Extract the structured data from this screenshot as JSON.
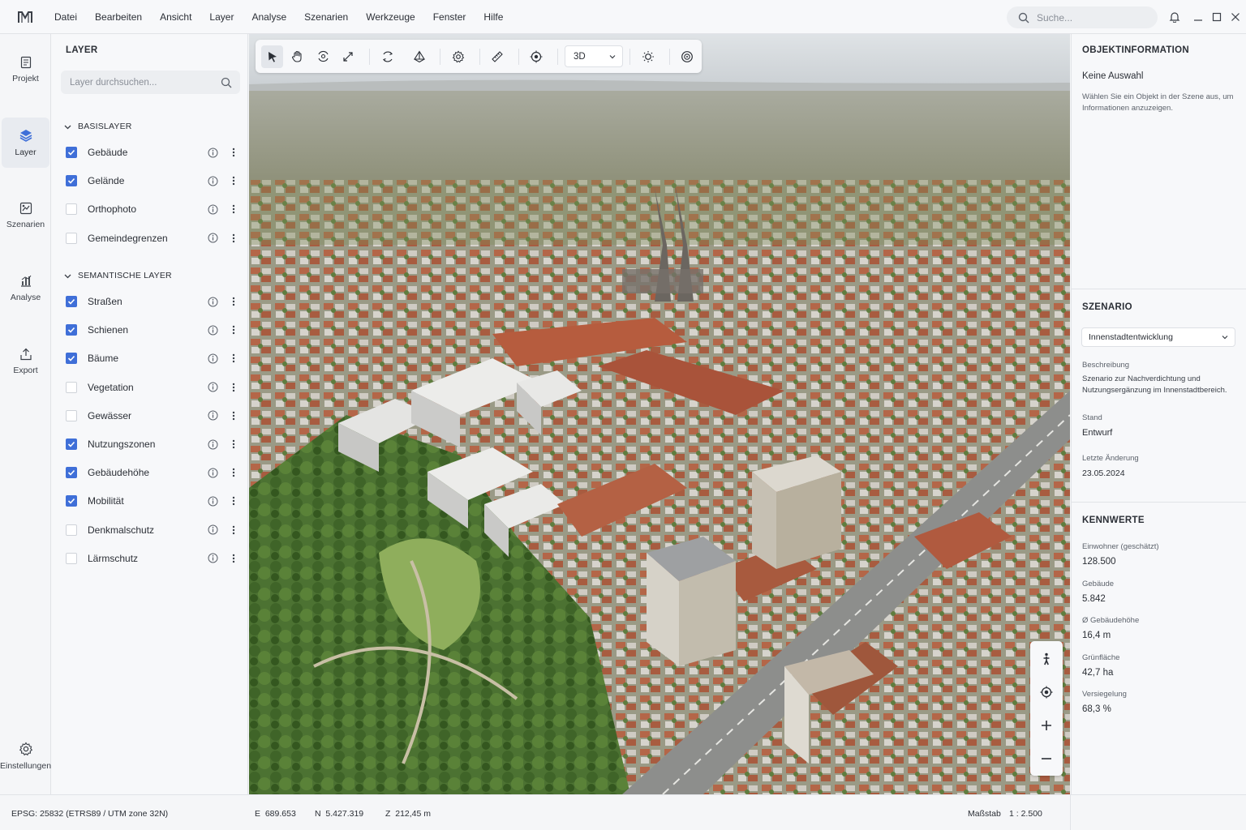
{
  "menu": {
    "logo": "M",
    "items": [
      "Datei",
      "Bearbeiten",
      "Ansicht",
      "Layer",
      "Analyse",
      "Szenarien",
      "Werkzeuge",
      "Fenster",
      "Hilfe"
    ]
  },
  "search": {
    "placeholder": "Suche..."
  },
  "window_controls": [
    "bell-icon",
    "minimize-icon",
    "maximize-icon",
    "close-icon"
  ],
  "rail": {
    "items": [
      {
        "label": "Projekt",
        "icon": "document-icon",
        "active": false
      },
      {
        "label": "Layer",
        "icon": "layers-icon",
        "active": true
      },
      {
        "label": "Szenarien",
        "icon": "scenario-icon",
        "active": false
      },
      {
        "label": "Analyse",
        "icon": "chart-icon",
        "active": false
      },
      {
        "label": "Export",
        "icon": "export-icon",
        "active": false
      }
    ],
    "settings_label": "Einstellungen"
  },
  "layers": {
    "title": "LAYER",
    "search_placeholder": "Layer durchsuchen...",
    "groups": [
      {
        "title": "BASISLAYER",
        "items": [
          {
            "label": "Gebäude",
            "checked": true
          },
          {
            "label": "Gelände",
            "checked": true
          },
          {
            "label": "Orthophoto",
            "checked": false
          },
          {
            "label": "Gemeindegrenzen",
            "checked": false
          }
        ]
      },
      {
        "title": "SEMANTISCHE LAYER",
        "items": [
          {
            "label": "Straßen",
            "checked": true
          },
          {
            "label": "Schienen",
            "checked": true
          },
          {
            "label": "Bäume",
            "checked": true
          },
          {
            "label": "Vegetation",
            "checked": false
          },
          {
            "label": "Gewässer",
            "checked": false
          },
          {
            "label": "Nutzungszonen",
            "checked": true
          },
          {
            "label": "Gebäudehöhe",
            "checked": true
          },
          {
            "label": "Mobilität",
            "checked": true
          },
          {
            "label": "Denkmalschutz",
            "checked": false
          },
          {
            "label": "Lärmschutz",
            "checked": false
          }
        ]
      }
    ]
  },
  "toolbar": {
    "tools": [
      "select-icon",
      "pan-icon",
      "rotate-view-icon",
      "fullscreen-icon",
      "orbit-icon",
      "terrain-icon",
      "settings-icon",
      "measure-icon",
      "target-icon"
    ],
    "view_mode": "3D",
    "extra_tools": [
      "sun-icon",
      "globe-icon"
    ]
  },
  "object_info": {
    "title": "OBJEKTINFORMATION",
    "selection": "Keine Auswahl",
    "hint": "Wählen Sie ein Objekt in der Szene aus, um Informationen anzuzeigen."
  },
  "scenario": {
    "title": "SZENARIO",
    "selected": "Innenstadtentwicklung",
    "description_label": "Beschreibung",
    "description": "Szenario zur Nachverdichtung und Nutzungsergänzung im Innenstadtbereich.",
    "status_label": "Stand",
    "status": "Entwurf",
    "last_change_label": "Letzte Änderung",
    "last_change": "23.05.2024"
  },
  "kpis": {
    "title": "KENNWERTE",
    "items": [
      {
        "label": "Einwohner (geschätzt)",
        "value": "128.500"
      },
      {
        "label": "Gebäude",
        "value": "5.842"
      },
      {
        "label": "Ø Gebäudehöhe",
        "value": "16,4 m"
      },
      {
        "label": "Grünfläche",
        "value": "42,7 ha"
      },
      {
        "label": "Versiegelung",
        "value": "68,3 %"
      }
    ]
  },
  "status": {
    "crs": "EPSG: 25832 (ETRS89 / UTM zone 32N)",
    "easting": "E  689.653",
    "northing": "N  5.427.319",
    "z": "Z  212,45 m",
    "scale_label": "Maßstab",
    "scale_value": "1 : 2.500"
  },
  "colors": {
    "accent": "#3f6fd8",
    "panel": "#f7f8fa",
    "border": "#e1e3e7"
  }
}
